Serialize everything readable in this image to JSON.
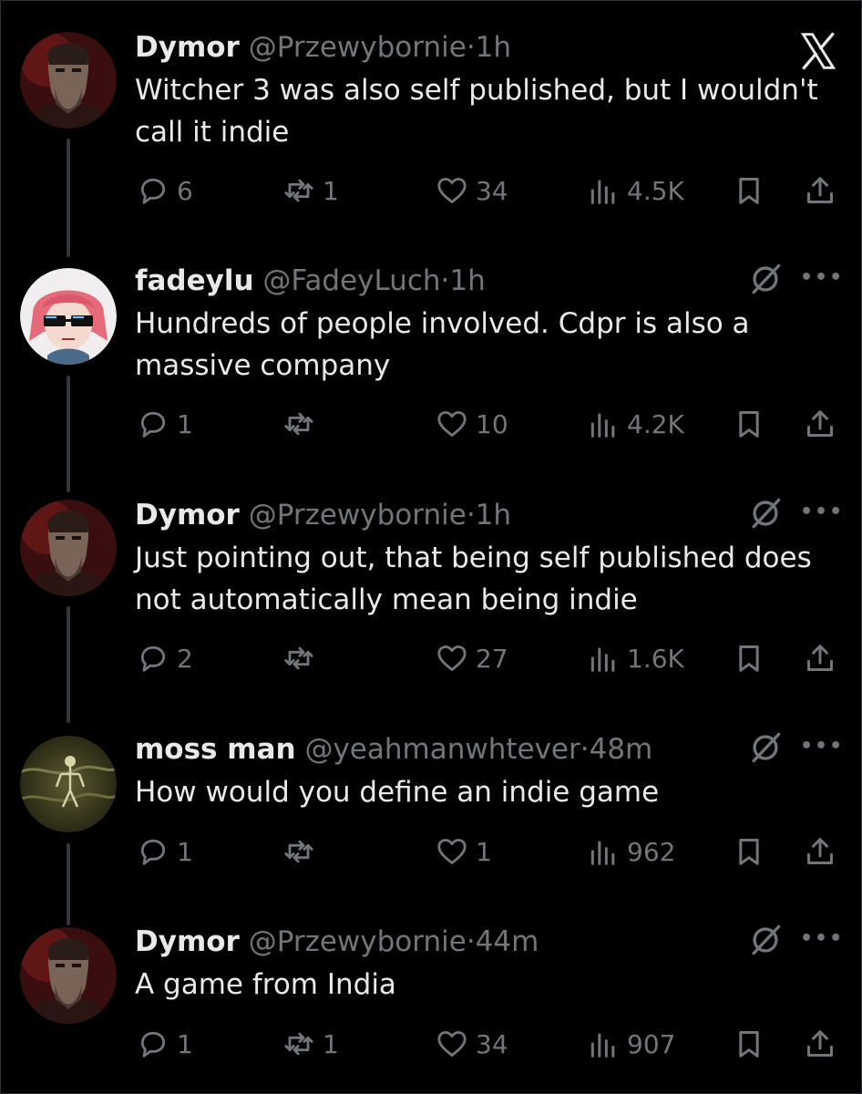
{
  "tweets": [
    {
      "name": "Dymor",
      "handle": "@Przewybornie",
      "time": "1h",
      "text": "Witcher 3 was also self published, but I wouldn't call it indie",
      "replies": "6",
      "retweets": "1",
      "likes": "34",
      "views": "4.5K",
      "avatar": "dymor"
    },
    {
      "name": "fadeylu",
      "handle": "@FadeyLuch",
      "time": "1h",
      "text": "Hundreds of people involved. Cdpr is also a massive company",
      "replies": "1",
      "retweets": "",
      "likes": "10",
      "views": "4.2K",
      "avatar": "fadeylu"
    },
    {
      "name": "Dymor",
      "handle": "@Przewybornie",
      "time": "1h",
      "text": "Just pointing out, that being self published does not automatically mean being indie",
      "replies": "2",
      "retweets": "",
      "likes": "27",
      "views": "1.6K",
      "avatar": "dymor"
    },
    {
      "name": "moss man",
      "handle": "@yeahmanwhtever",
      "time": "48m",
      "text": "How would you define an indie game",
      "replies": "1",
      "retweets": "",
      "likes": "1",
      "views": "962",
      "avatar": "moss"
    },
    {
      "name": "Dymor",
      "handle": "@Przewybornie",
      "time": "44m",
      "text": "A game from India",
      "replies": "1",
      "retweets": "1",
      "likes": "34",
      "views": "907",
      "avatar": "dymor"
    }
  ],
  "separator": "·",
  "more_label": "•••",
  "icons": {
    "brand": "x-logo-icon",
    "reply": "reply-icon",
    "retweet": "retweet-icon",
    "like": "heart-icon",
    "views": "views-icon",
    "bookmark": "bookmark-icon",
    "share": "share-icon",
    "grok": "grok-icon"
  }
}
